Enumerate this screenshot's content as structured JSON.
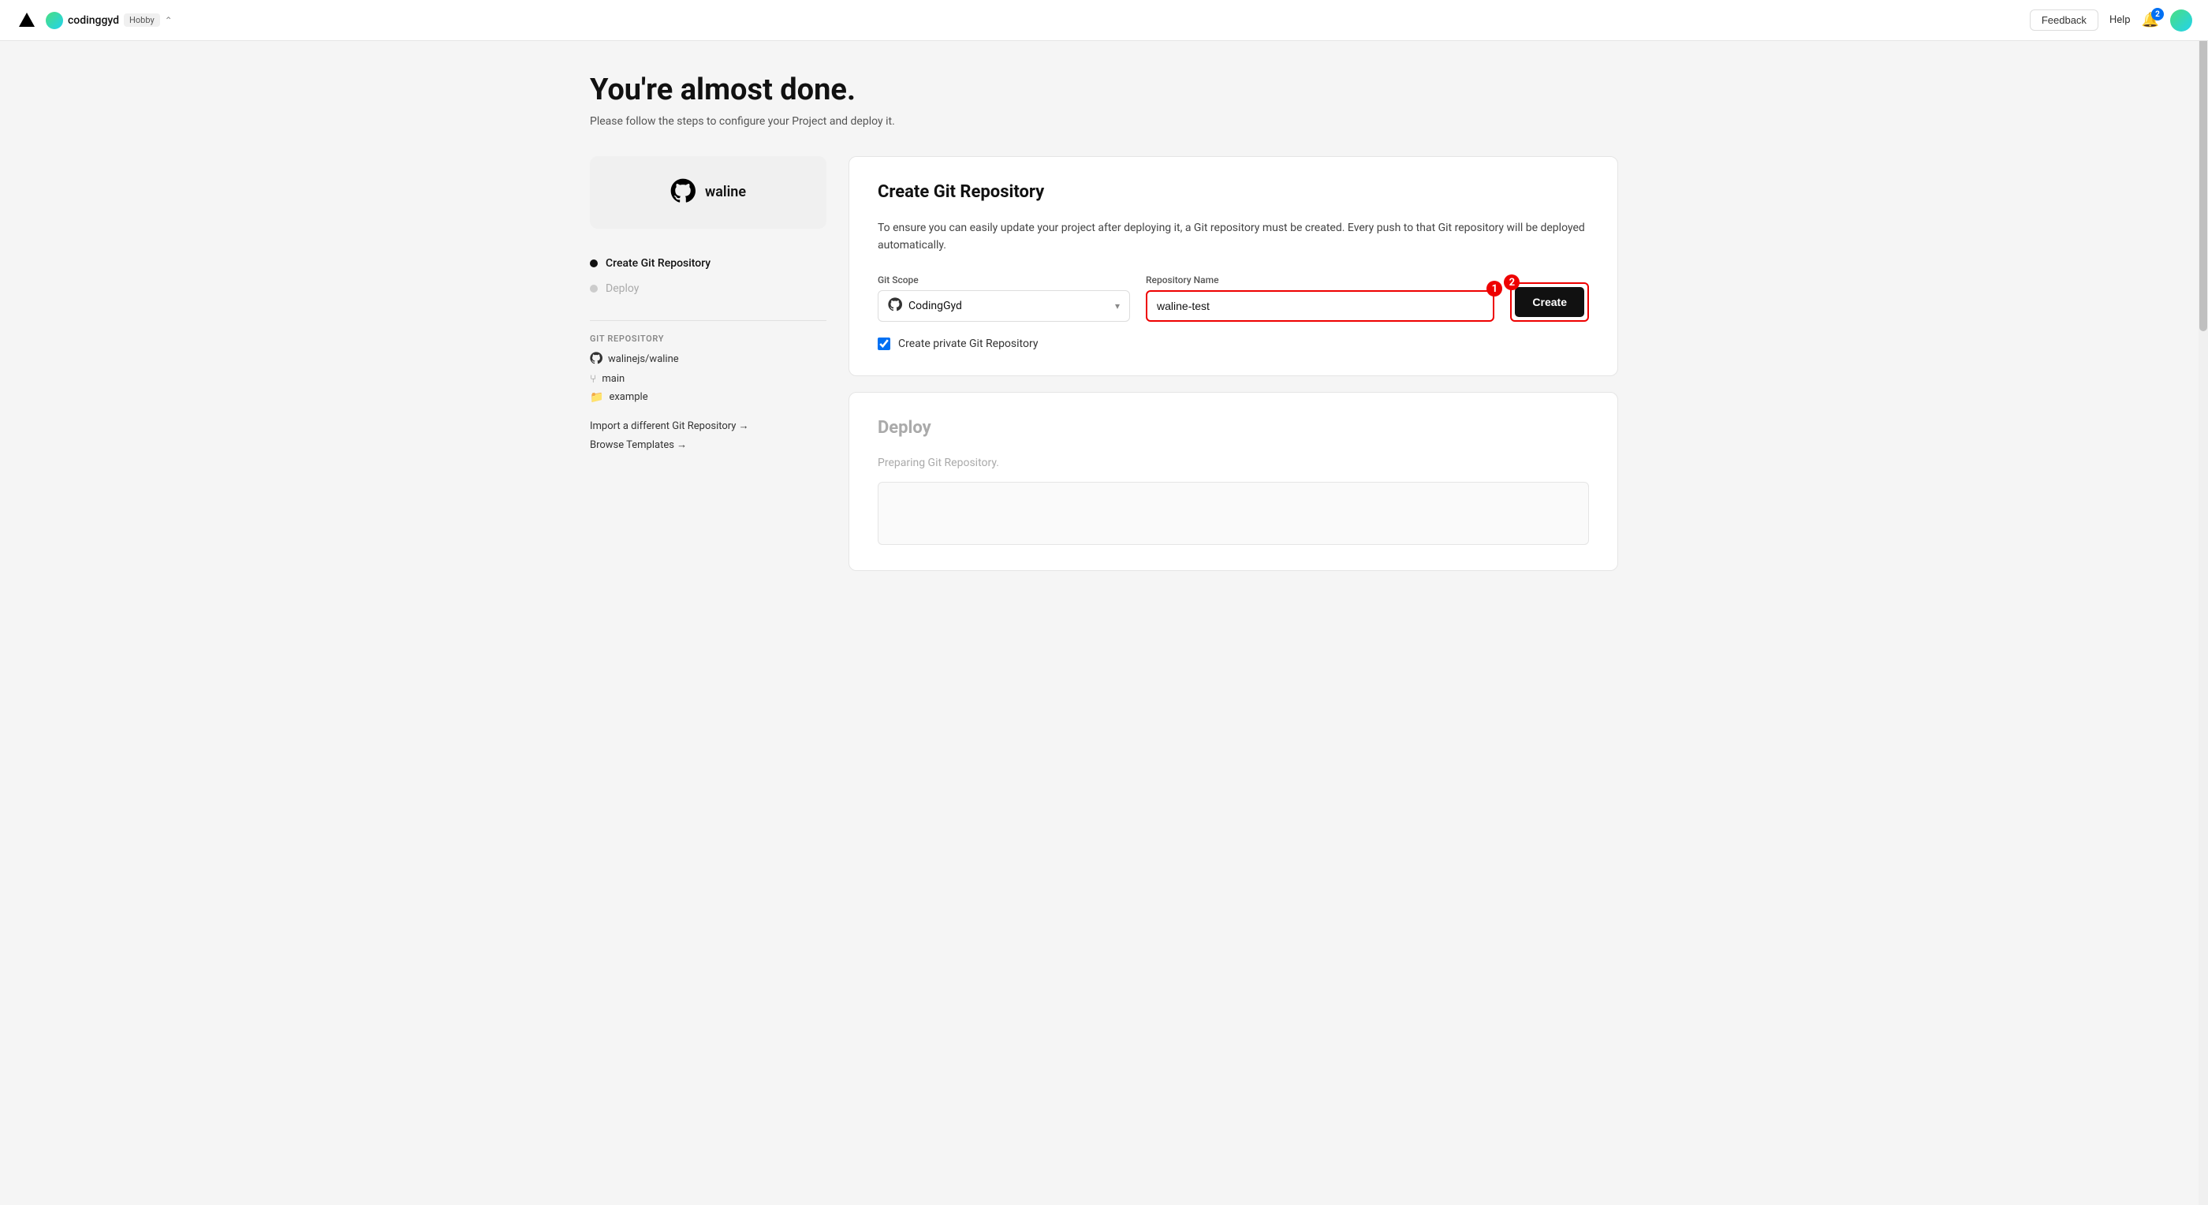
{
  "topnav": {
    "logo_label": "Vercel",
    "org_name": "codinggyd",
    "org_badge": "Hobby",
    "feedback_label": "Feedback",
    "help_label": "Help",
    "bell_count": "2"
  },
  "page": {
    "title": "You're almost done.",
    "subtitle": "Please follow the steps to configure your Project and deploy it."
  },
  "sidebar": {
    "project_name": "waline",
    "steps": [
      {
        "label": "Create Git Repository",
        "active": true
      },
      {
        "label": "Deploy",
        "active": false
      }
    ],
    "git_repo_section": "GIT REPOSITORY",
    "git_repo_link": "walinejs/waline",
    "git_branch": "main",
    "git_folder": "example",
    "import_link": "Import a different Git Repository →",
    "browse_link": "Browse Templates →"
  },
  "create_git": {
    "title": "Create Git Repository",
    "description": "To ensure you can easily update your project after deploying it, a Git repository must be created. Every push to that Git repository will be deployed automatically.",
    "git_scope_label": "Git Scope",
    "scope_value": "CodingGyd",
    "repo_name_label": "Repository Name",
    "repo_name_value": "waline-test",
    "create_private_label": "Create private Git Repository",
    "create_btn_label": "Create",
    "annotation_1": "1",
    "annotation_2": "2"
  },
  "deploy": {
    "title": "Deploy",
    "preparing_text": "Preparing Git Repository."
  }
}
